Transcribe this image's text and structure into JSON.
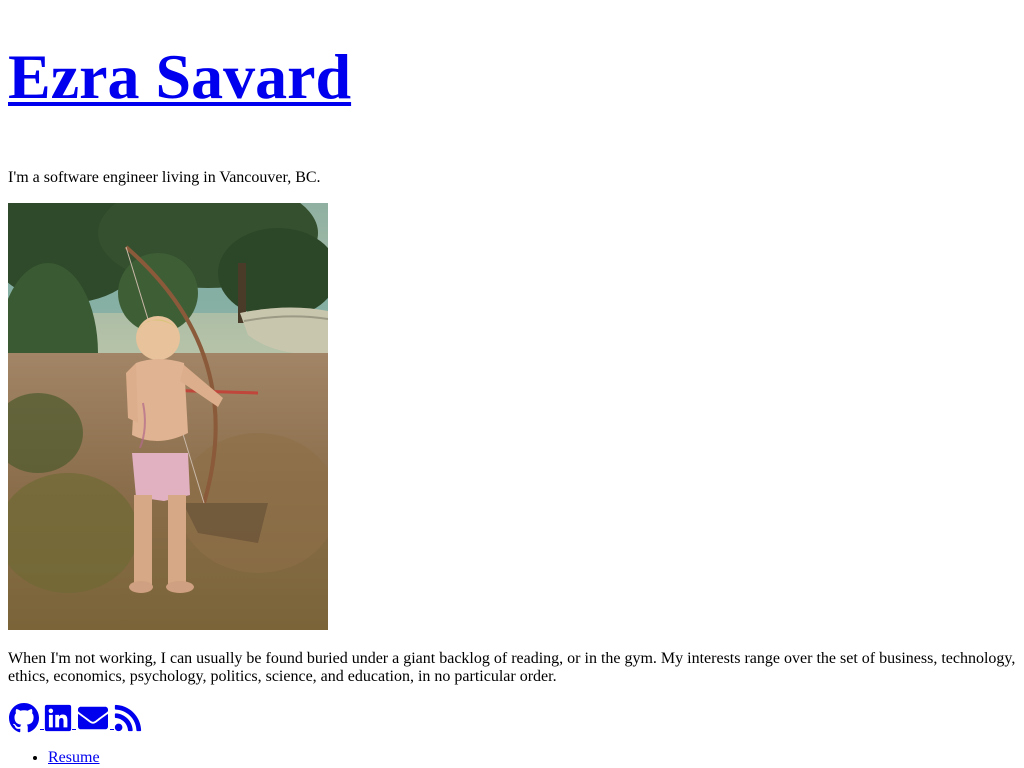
{
  "header": {
    "title": "Ezra Savard"
  },
  "intro": {
    "tagline": "I'm a software engineer living in Vancouver, BC."
  },
  "about": {
    "bio": "When I'm not working, I can usually be found buried under a giant backlog of reading, or in the gym. My interests range over the set of business, technology, ethics, economics, psychology, politics, science, and education, in no particular order."
  },
  "social": {
    "links": [
      {
        "icon": "github-icon"
      },
      {
        "icon": "linkedin-icon"
      },
      {
        "icon": "email-icon"
      },
      {
        "icon": "rss-icon"
      }
    ],
    "link_color": "#0000ee"
  },
  "nav": {
    "items": [
      {
        "label": "Resume"
      }
    ]
  }
}
